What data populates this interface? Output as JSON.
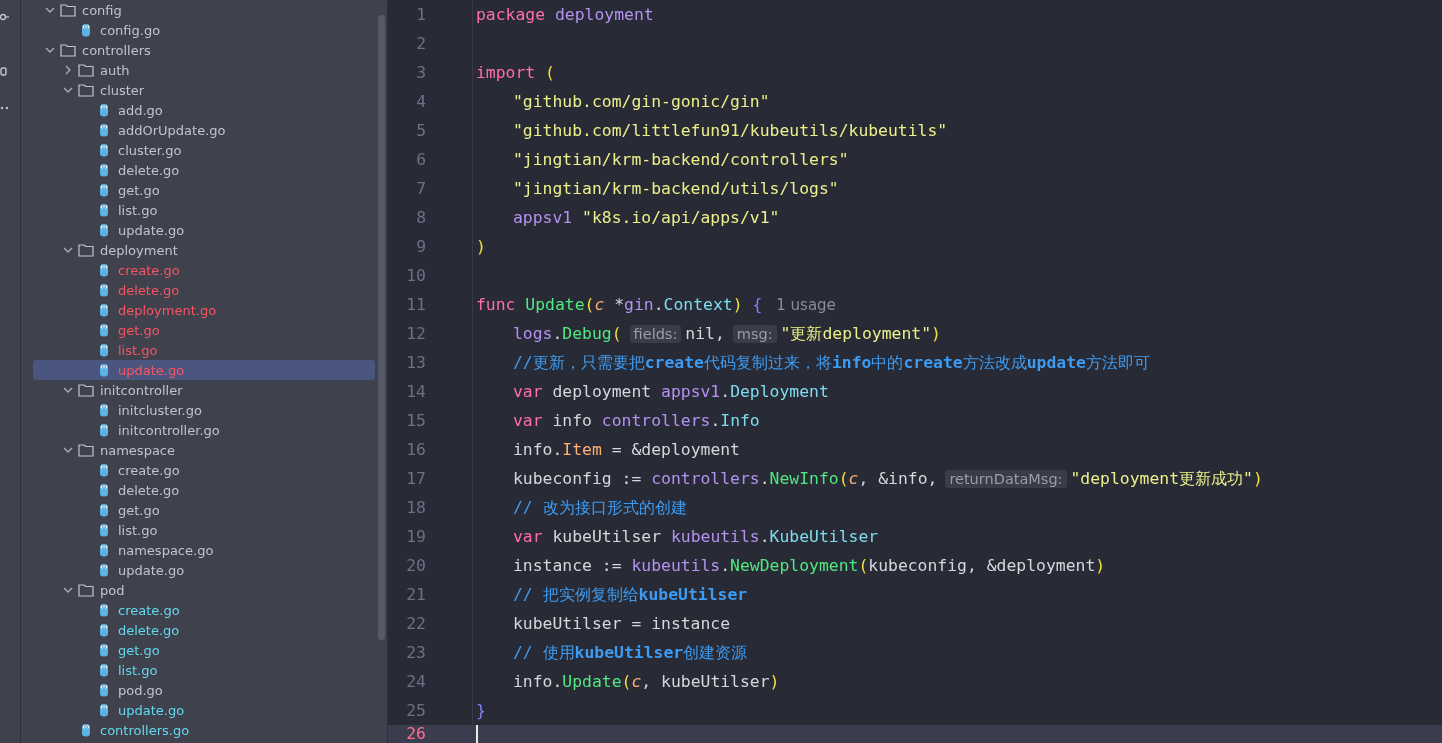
{
  "tree": [
    {
      "kind": "folder",
      "name": "config",
      "expanded": true,
      "selected": false,
      "children": [
        {
          "kind": "file",
          "name": "config.go",
          "selected": false
        }
      ]
    },
    {
      "kind": "folder",
      "name": "controllers",
      "expanded": true,
      "selected": false,
      "children": [
        {
          "kind": "folder",
          "name": "auth",
          "expanded": false,
          "selected": false
        },
        {
          "kind": "folder",
          "name": "cluster",
          "expanded": true,
          "selected": false,
          "children": [
            {
              "kind": "file",
              "name": "add.go",
              "selected": false
            },
            {
              "kind": "file",
              "name": "addOrUpdate.go",
              "selected": false
            },
            {
              "kind": "file",
              "name": "cluster.go",
              "selected": false
            },
            {
              "kind": "file",
              "name": "delete.go",
              "selected": false
            },
            {
              "kind": "file",
              "name": "get.go",
              "selected": false
            },
            {
              "kind": "file",
              "name": "list.go",
              "selected": false
            },
            {
              "kind": "file",
              "name": "update.go",
              "selected": false
            }
          ]
        },
        {
          "kind": "folder",
          "name": "deployment",
          "expanded": true,
          "selected": false,
          "children": [
            {
              "kind": "file",
              "name": "create.go",
              "selected": false,
              "color": "#f75464"
            },
            {
              "kind": "file",
              "name": "delete.go",
              "selected": false,
              "color": "#f75464"
            },
            {
              "kind": "file",
              "name": "deployment.go",
              "selected": false,
              "color": "#f75464"
            },
            {
              "kind": "file",
              "name": "get.go",
              "selected": false,
              "color": "#f75464"
            },
            {
              "kind": "file",
              "name": "list.go",
              "selected": false,
              "color": "#f75464"
            },
            {
              "kind": "file",
              "name": "update.go",
              "selected": true,
              "color": "#f75464"
            }
          ]
        },
        {
          "kind": "folder",
          "name": "initcontroller",
          "expanded": true,
          "selected": false,
          "children": [
            {
              "kind": "file",
              "name": "initcluster.go",
              "selected": false
            },
            {
              "kind": "file",
              "name": "initcontroller.go",
              "selected": false
            }
          ]
        },
        {
          "kind": "folder",
          "name": "namespace",
          "expanded": true,
          "selected": false,
          "children": [
            {
              "kind": "file",
              "name": "create.go",
              "selected": false
            },
            {
              "kind": "file",
              "name": "delete.go",
              "selected": false
            },
            {
              "kind": "file",
              "name": "get.go",
              "selected": false
            },
            {
              "kind": "file",
              "name": "list.go",
              "selected": false
            },
            {
              "kind": "file",
              "name": "namespace.go",
              "selected": false
            },
            {
              "kind": "file",
              "name": "update.go",
              "selected": false
            }
          ]
        },
        {
          "kind": "folder",
          "name": "pod",
          "expanded": true,
          "selected": false,
          "children": [
            {
              "kind": "file",
              "name": "create.go",
              "selected": false,
              "color": "#62d8ee"
            },
            {
              "kind": "file",
              "name": "delete.go",
              "selected": false,
              "color": "#62d8ee"
            },
            {
              "kind": "file",
              "name": "get.go",
              "selected": false,
              "color": "#62d8ee"
            },
            {
              "kind": "file",
              "name": "list.go",
              "selected": false,
              "color": "#62d8ee"
            },
            {
              "kind": "file",
              "name": "pod.go",
              "selected": false
            },
            {
              "kind": "file",
              "name": "update.go",
              "selected": false,
              "color": "#62d8ee"
            }
          ]
        },
        {
          "kind": "file",
          "name": "controllers.go",
          "selected": false,
          "color": "#62d8ee"
        }
      ]
    }
  ],
  "editor": {
    "lines": [
      {
        "number": "1",
        "indented": false,
        "current": false,
        "tokens": [
          {
            "kind": "keyword",
            "text": "package "
          },
          {
            "kind": "package",
            "text": "deployment"
          }
        ]
      },
      {
        "number": "2",
        "current": false
      },
      {
        "number": "3",
        "indented": false,
        "current": false,
        "tokens": [
          {
            "kind": "keyword",
            "text": "import "
          },
          {
            "kind": "paren",
            "text": "("
          }
        ]
      },
      {
        "number": "4",
        "indented": true,
        "current": false,
        "tokens": [
          {
            "kind": "string",
            "text": "\"github.com/gin-gonic/gin\""
          }
        ]
      },
      {
        "number": "5",
        "indented": true,
        "current": false,
        "tokens": [
          {
            "kind": "string",
            "text": "\"github.com/littlefun91/kubeutils/kubeutils\""
          }
        ]
      },
      {
        "number": "6",
        "indented": true,
        "current": false,
        "tokens": [
          {
            "kind": "string",
            "text": "\"jingtian/krm-backend/controllers\""
          }
        ]
      },
      {
        "number": "7",
        "indented": true,
        "current": false,
        "tokens": [
          {
            "kind": "string",
            "text": "\"jingtian/krm-backend/utils/logs\""
          }
        ]
      },
      {
        "number": "8",
        "indented": true,
        "current": false,
        "tokens": [
          {
            "kind": "package",
            "text": "appsv1 "
          },
          {
            "kind": "string",
            "text": "\"k8s.io/api/apps/v1\""
          }
        ]
      },
      {
        "number": "9",
        "indented": false,
        "current": false,
        "tokens": [
          {
            "kind": "paren",
            "text": ")"
          }
        ]
      },
      {
        "number": "10",
        "current": false
      },
      {
        "number": "11",
        "indented": false,
        "current": false,
        "tokens": [
          {
            "kind": "keyword",
            "text": "func "
          },
          {
            "kind": "function",
            "text": "Update"
          },
          {
            "kind": "paren",
            "text": "("
          },
          {
            "kind": "param",
            "text": "c"
          },
          {
            "kind": "plain",
            "text": " *"
          },
          {
            "kind": "package",
            "text": "gin"
          },
          {
            "kind": "plain",
            "text": "."
          },
          {
            "kind": "type",
            "text": "Context"
          },
          {
            "kind": "paren",
            "text": ") "
          },
          {
            "kind": "brace",
            "text": "{"
          },
          {
            "kind": "usage",
            "text": "1 usage"
          }
        ]
      },
      {
        "number": "12",
        "indented": true,
        "current": false,
        "tokens": [
          {
            "kind": "package",
            "text": "logs"
          },
          {
            "kind": "plain",
            "text": "."
          },
          {
            "kind": "function",
            "text": "Debug"
          },
          {
            "kind": "paren",
            "text": "("
          },
          {
            "kind": "hint",
            "text": "fields:"
          },
          {
            "kind": "plain",
            "text": "nil,"
          },
          {
            "kind": "hint",
            "text": "msg:"
          },
          {
            "kind": "string",
            "text": "\"更新deployment\""
          },
          {
            "kind": "paren",
            "text": ")"
          }
        ]
      },
      {
        "number": "13",
        "indented": true,
        "current": false,
        "tokens": [
          {
            "kind": "comment",
            "text": "//更新，只需要把**create**代码复制过来，将**info**中的**create**方法改成**update**方法即可"
          }
        ]
      },
      {
        "number": "14",
        "indented": true,
        "current": false,
        "tokens": [
          {
            "kind": "keyword",
            "text": "var"
          },
          {
            "kind": "plain",
            "text": " deployment "
          },
          {
            "kind": "package",
            "text": "appsv1"
          },
          {
            "kind": "plain",
            "text": "."
          },
          {
            "kind": "type",
            "text": "Deployment"
          }
        ]
      },
      {
        "number": "15",
        "indented": true,
        "current": false,
        "tokens": [
          {
            "kind": "keyword",
            "text": "var"
          },
          {
            "kind": "plain",
            "text": " info "
          },
          {
            "kind": "package",
            "text": "controllers"
          },
          {
            "kind": "plain",
            "text": "."
          },
          {
            "kind": "type",
            "text": "Info"
          }
        ]
      },
      {
        "number": "16",
        "indented": true,
        "current": false,
        "tokens": [
          {
            "kind": "plain",
            "text": "info."
          },
          {
            "kind": "field",
            "text": "Item"
          },
          {
            "kind": "plain",
            "text": " = &deployment"
          }
        ]
      },
      {
        "number": "17",
        "indented": true,
        "current": false,
        "tokens": [
          {
            "kind": "plain",
            "text": "kubeconfig := "
          },
          {
            "kind": "package",
            "text": "controllers"
          },
          {
            "kind": "plain",
            "text": "."
          },
          {
            "kind": "function",
            "text": "NewInfo"
          },
          {
            "kind": "paren",
            "text": "("
          },
          {
            "kind": "param",
            "text": "c"
          },
          {
            "kind": "plain",
            "text": ", &info,"
          },
          {
            "kind": "hint",
            "text": "returnDataMsg:"
          },
          {
            "kind": "string",
            "text": "\"deployment更新成功\""
          },
          {
            "kind": "paren",
            "text": ")"
          }
        ]
      },
      {
        "number": "18",
        "indented": true,
        "current": false,
        "tokens": [
          {
            "kind": "comment",
            "text": "// 改为接口形式的创建"
          }
        ]
      },
      {
        "number": "19",
        "indented": true,
        "current": false,
        "tokens": [
          {
            "kind": "keyword",
            "text": "var"
          },
          {
            "kind": "plain",
            "text": " kubeUtilser "
          },
          {
            "kind": "package",
            "text": "kubeutils"
          },
          {
            "kind": "plain",
            "text": "."
          },
          {
            "kind": "type",
            "text": "KubeUtilser"
          }
        ]
      },
      {
        "number": "20",
        "indented": true,
        "current": false,
        "tokens": [
          {
            "kind": "plain",
            "text": "instance := "
          },
          {
            "kind": "package",
            "text": "kubeutils"
          },
          {
            "kind": "plain",
            "text": "."
          },
          {
            "kind": "function",
            "text": "NewDeployment"
          },
          {
            "kind": "paren",
            "text": "("
          },
          {
            "kind": "plain",
            "text": "kubeconfig, &deployment"
          },
          {
            "kind": "paren",
            "text": ")"
          }
        ]
      },
      {
        "number": "21",
        "indented": true,
        "current": false,
        "tokens": [
          {
            "kind": "comment",
            "text": "// 把实例复制给**kubeUtilser**"
          }
        ]
      },
      {
        "number": "22",
        "indented": true,
        "current": false,
        "tokens": [
          {
            "kind": "plain",
            "text": "kubeUtilser = instance"
          }
        ]
      },
      {
        "number": "23",
        "indented": true,
        "current": false,
        "tokens": [
          {
            "kind": "comment",
            "text": "// 使用**kubeUtilser**创建资源"
          }
        ]
      },
      {
        "number": "24",
        "indented": true,
        "current": false,
        "tokens": [
          {
            "kind": "plain",
            "text": "info."
          },
          {
            "kind": "function",
            "text": "Update"
          },
          {
            "kind": "paren",
            "text": "("
          },
          {
            "kind": "param",
            "text": "c"
          },
          {
            "kind": "plain",
            "text": ", kubeUtilser"
          },
          {
            "kind": "paren",
            "text": ")"
          }
        ]
      },
      {
        "number": "25",
        "indented": false,
        "current": false,
        "tokens": [
          {
            "kind": "brace",
            "text": "}"
          }
        ]
      },
      {
        "number": "26",
        "current": true
      }
    ]
  }
}
